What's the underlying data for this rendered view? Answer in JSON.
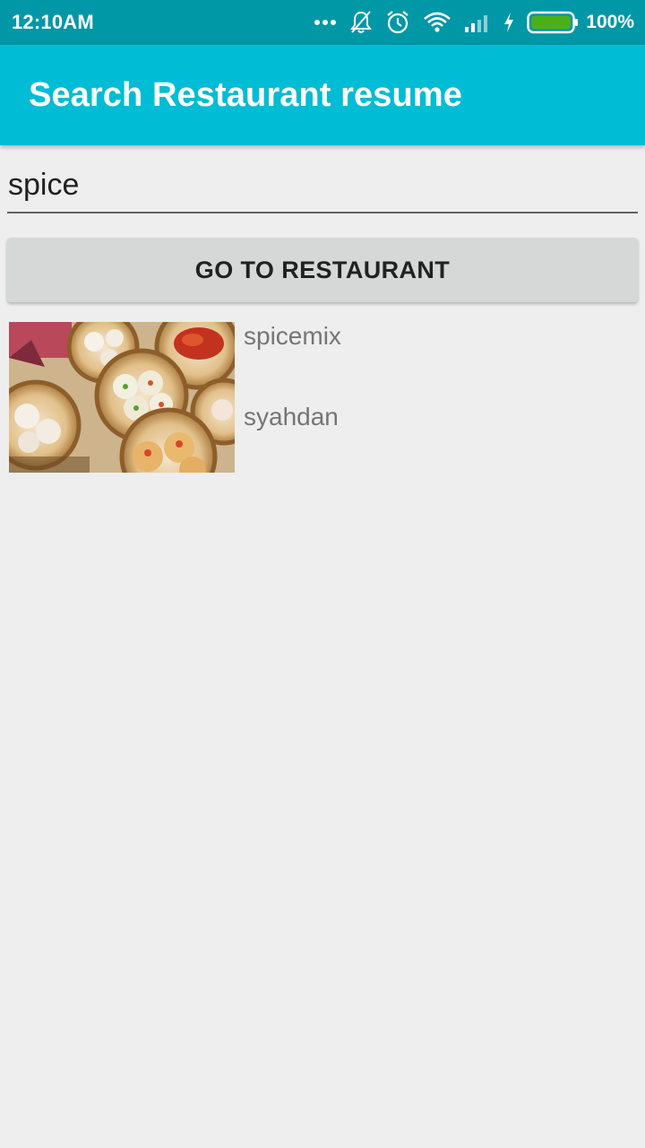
{
  "status_bar": {
    "time": "12:10AM",
    "battery_percent": "100%",
    "icons": [
      "more-dots-icon",
      "bell-off-icon",
      "alarm-icon",
      "wifi-icon",
      "signal-icon",
      "charging-bolt-icon",
      "battery-icon"
    ]
  },
  "app_bar": {
    "title": "Search Restaurant resume"
  },
  "search": {
    "value": "spice"
  },
  "actions": {
    "go_button_label": "GO TO RESTAURANT"
  },
  "results": [
    {
      "name": "spicemix",
      "owner": "syahdan",
      "thumbnail": "dim-sum-photo"
    }
  ],
  "colors": {
    "status_bar": "#0097a7",
    "app_bar": "#00bcd4",
    "background": "#eeeeee",
    "button": "#d6d7d7",
    "battery_fill": "#4caf1a"
  }
}
